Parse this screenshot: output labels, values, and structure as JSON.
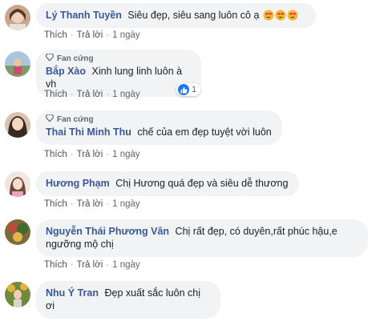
{
  "actions": {
    "like": "Thích",
    "reply": "Trả lời",
    "sep": "·"
  },
  "comments": [
    {
      "author": "Lý Thanh Tuyền",
      "text": "Siêu đẹp, siêu sang luôn cô ạ",
      "badge": "",
      "time": "1 ngày",
      "emoji_count": 3
    },
    {
      "author": "Bắp Xào",
      "text": "Xinh lung linh luôn à vh",
      "badge": "Fan cứng",
      "time": "1 ngày",
      "reactions": "1"
    },
    {
      "author": "Thai Thi Minh Thu",
      "text": "chế của em đẹp tuyệt vời luôn",
      "badge": "Fan cứng",
      "time": "1 ngày"
    },
    {
      "author": "Hương Phạm",
      "text": "Chị Hương quá đẹp và siêu dễ thương",
      "badge": "",
      "time": "1 ngày"
    },
    {
      "author": "Nguyễn Thái Phương Vân",
      "text_line1": "Chị rất đẹp, có duyên,rất phúc hậu,e",
      "text_line2": "ngưỡng mộ chị",
      "badge": "",
      "time": "1 ngày"
    },
    {
      "author": "Nhu Ý Tran",
      "text": "Đẹp xuất sắc luôn chị ơi",
      "badge": "",
      "time": ""
    }
  ],
  "icons": {
    "badge": "diamond-icon",
    "reaction": "like-icon",
    "emoji": "heart-eyes-emoji"
  },
  "colors": {
    "author": "#385898",
    "bubble": "#f2f3f5",
    "meta": "#606770",
    "like": "#1877f2"
  }
}
